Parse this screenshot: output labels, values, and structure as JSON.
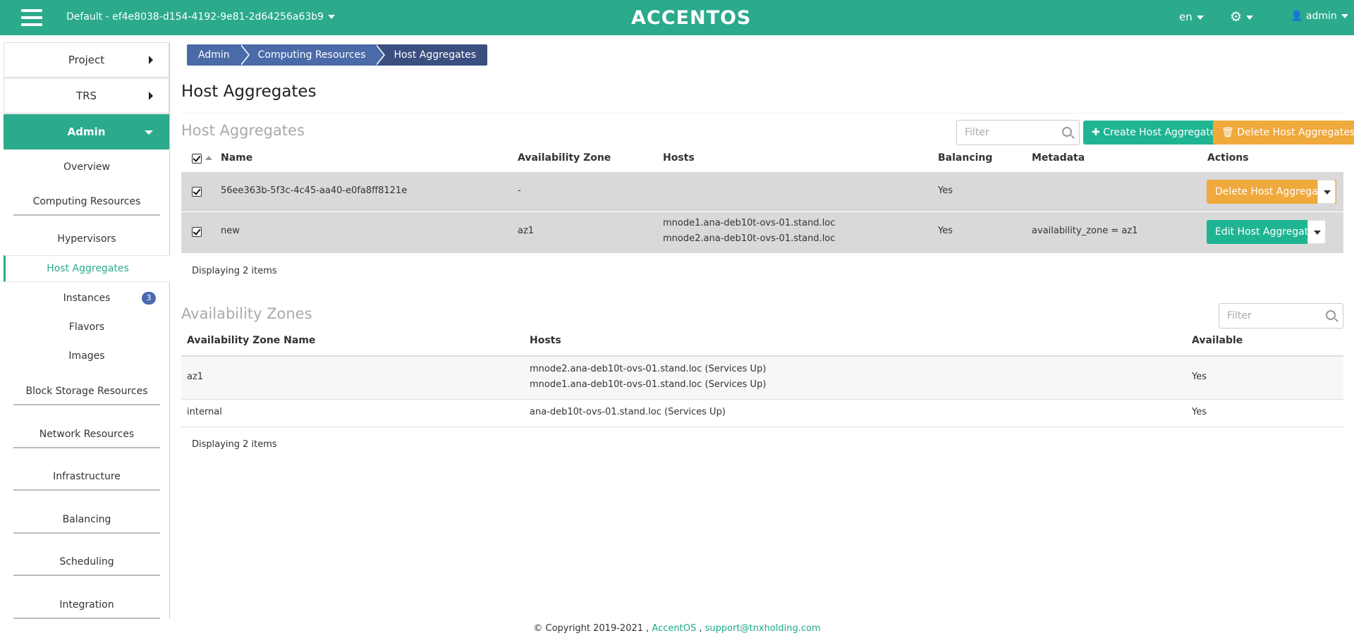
{
  "topbar": {
    "project": "Default - ef4e8038-d154-4192-9e81-2d64256a63b9",
    "brand": "ACCENTOS",
    "language": "en",
    "user": "admin"
  },
  "sidebar": {
    "categories": [
      "Project",
      "TRS",
      "Admin"
    ],
    "items": {
      "overview": "Overview",
      "computing": "Computing Resources",
      "hypervisors": "Hypervisors",
      "host_aggregates": "Host Aggregates",
      "instances": "Instances",
      "instances_badge": "3",
      "flavors": "Flavors",
      "images": "Images",
      "block_storage": "Block Storage Resources",
      "network": "Network Resources",
      "infrastructure": "Infrastructure",
      "balancing": "Balancing",
      "scheduling": "Scheduling",
      "integration": "Integration"
    }
  },
  "breadcrumb": [
    "Admin",
    "Computing Resources",
    "Host Aggregates"
  ],
  "page_title": "Host Aggregates",
  "host_aggregates": {
    "title": "Host Aggregates",
    "filter_placeholder": "Filter",
    "create_button": "Create Host Aggregate",
    "delete_button": "Delete Host Aggregates",
    "columns": [
      "Name",
      "Availability Zone",
      "Hosts",
      "Balancing",
      "Metadata",
      "Actions"
    ],
    "rows": [
      {
        "name": "56ee363b-5f3c-4c45-aa40-e0fa8ff8121e",
        "zone": "-",
        "hosts": [
          "",
          ""
        ],
        "balancing": "Yes",
        "metadata": "",
        "action": "Delete Host Aggregate"
      },
      {
        "name": "new",
        "zone": "az1",
        "hosts": [
          "mnode1.ana-deb10t-ovs-01.stand.loc",
          "mnode2.ana-deb10t-ovs-01.stand.loc"
        ],
        "balancing": "Yes",
        "metadata": "availability_zone = az1",
        "action": "Edit Host Aggregate"
      }
    ],
    "footer": "Displaying 2 items"
  },
  "availability_zones": {
    "title": "Availability Zones",
    "filter_placeholder": "Filter",
    "columns": [
      "Availability Zone Name",
      "Hosts",
      "Available"
    ],
    "rows": [
      {
        "name": "az1",
        "hosts": [
          "mnode2.ana-deb10t-ovs-01.stand.loc (Services Up)",
          "mnode1.ana-deb10t-ovs-01.stand.loc (Services Up)"
        ],
        "available": "Yes"
      },
      {
        "name": "internal",
        "hosts": [
          "ana-deb10t-ovs-01.stand.loc (Services Up)"
        ],
        "available": "Yes"
      }
    ],
    "footer": "Displaying 2 items"
  },
  "footer": {
    "copyright": "© Copyright 2019-2021 ,",
    "link1": "AccentOS",
    "sep": ",",
    "link2": "support@tnxholding.com"
  }
}
